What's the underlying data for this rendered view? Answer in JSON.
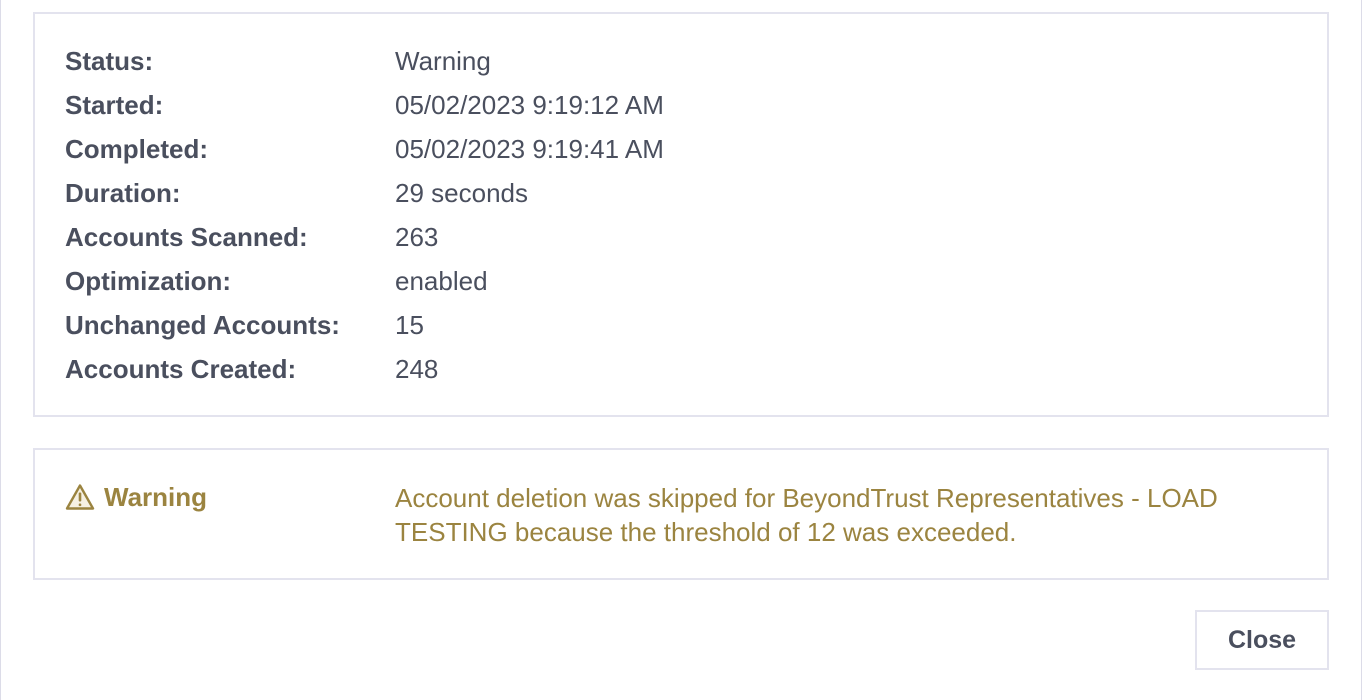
{
  "details": [
    {
      "label": "Status:",
      "value": "Warning"
    },
    {
      "label": "Started:",
      "value": "05/02/2023 9:19:12 AM"
    },
    {
      "label": "Completed:",
      "value": "05/02/2023 9:19:41 AM"
    },
    {
      "label": "Duration:",
      "value": "29 seconds"
    },
    {
      "label": "Accounts Scanned:",
      "value": "263"
    },
    {
      "label": "Optimization:",
      "value": "enabled"
    },
    {
      "label": "Unchanged Accounts:",
      "value": "15"
    },
    {
      "label": "Accounts Created:",
      "value": "248"
    }
  ],
  "warning": {
    "icon": "warning-triangle-icon",
    "title": "Warning",
    "message": "Account deletion was skipped for BeyondTrust Representatives - LOAD TESTING because the threshold of 12 was exceeded.",
    "color": "#9b8440"
  },
  "actions": {
    "close_label": "Close"
  },
  "colors": {
    "text": "#4a4f5e",
    "border": "#e3e3ee",
    "warning": "#9b8440"
  }
}
